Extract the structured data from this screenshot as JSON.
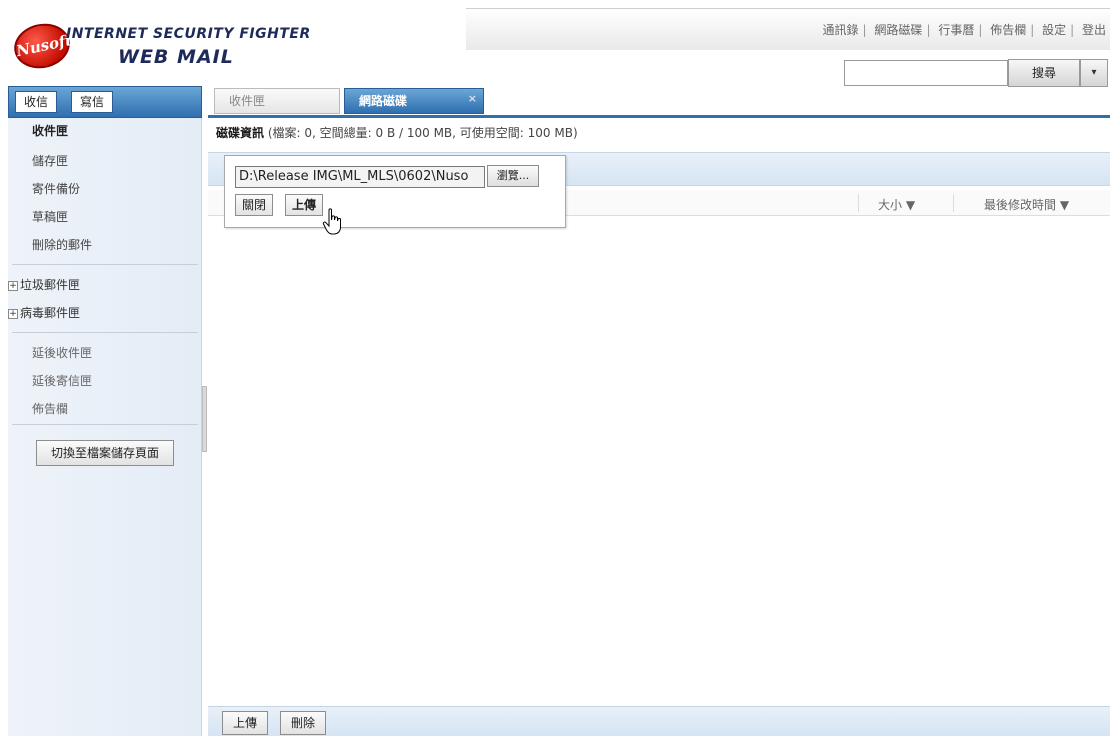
{
  "brand": {
    "badge_text": "Nusoft",
    "line1": "INTERNET SECURITY FIGHTER",
    "line2": "WEB MAIL"
  },
  "top_links": [
    "通訊錄",
    "網路磁碟",
    "行事曆",
    "佈告欄",
    "設定",
    "登出"
  ],
  "search": {
    "value": "",
    "button_label": "搜尋",
    "dropdown_icon": "▾"
  },
  "compose": {
    "receive_label": "收信",
    "write_label": "寫信"
  },
  "tabs": [
    {
      "label": "收件匣",
      "active": false
    },
    {
      "label": "網路磁碟",
      "active": true,
      "close_icon": "×"
    }
  ],
  "sidebar": {
    "folders": [
      "收件匣",
      "儲存匣",
      "寄件備份",
      "草稿匣",
      "刪除的郵件"
    ],
    "tree": [
      {
        "label": "垃圾郵件匣",
        "expand_icon": "+"
      },
      {
        "label": "病毒郵件匣",
        "expand_icon": "+"
      }
    ],
    "extras": [
      "延後收件匣",
      "延後寄信匣",
      "佈告欄"
    ],
    "switch_button": "切換至檔案儲存頁面"
  },
  "disk_info": {
    "title": "磁碟資訊",
    "detail": "(檔案: 0, 空間總量: 0 B / 100 MB, 可使用空間: 100 MB)"
  },
  "columns": {
    "size": "大小 ▼",
    "modified": "最後修改時間 ▼"
  },
  "upload_popup": {
    "path_value": "D:\\Release IMG\\ML_MLS\\0602\\Nuso",
    "browse_label": "瀏覽...",
    "close_label": "關閉",
    "upload_label": "上傳"
  },
  "bottom": {
    "upload_label": "上傳",
    "delete_label": "刪除"
  },
  "colors": {
    "accent": "#2f6fb0",
    "sidebar_bg": "#e4ecf6",
    "brand_red": "#c40d00",
    "brand_navy": "#1d2a5a"
  }
}
